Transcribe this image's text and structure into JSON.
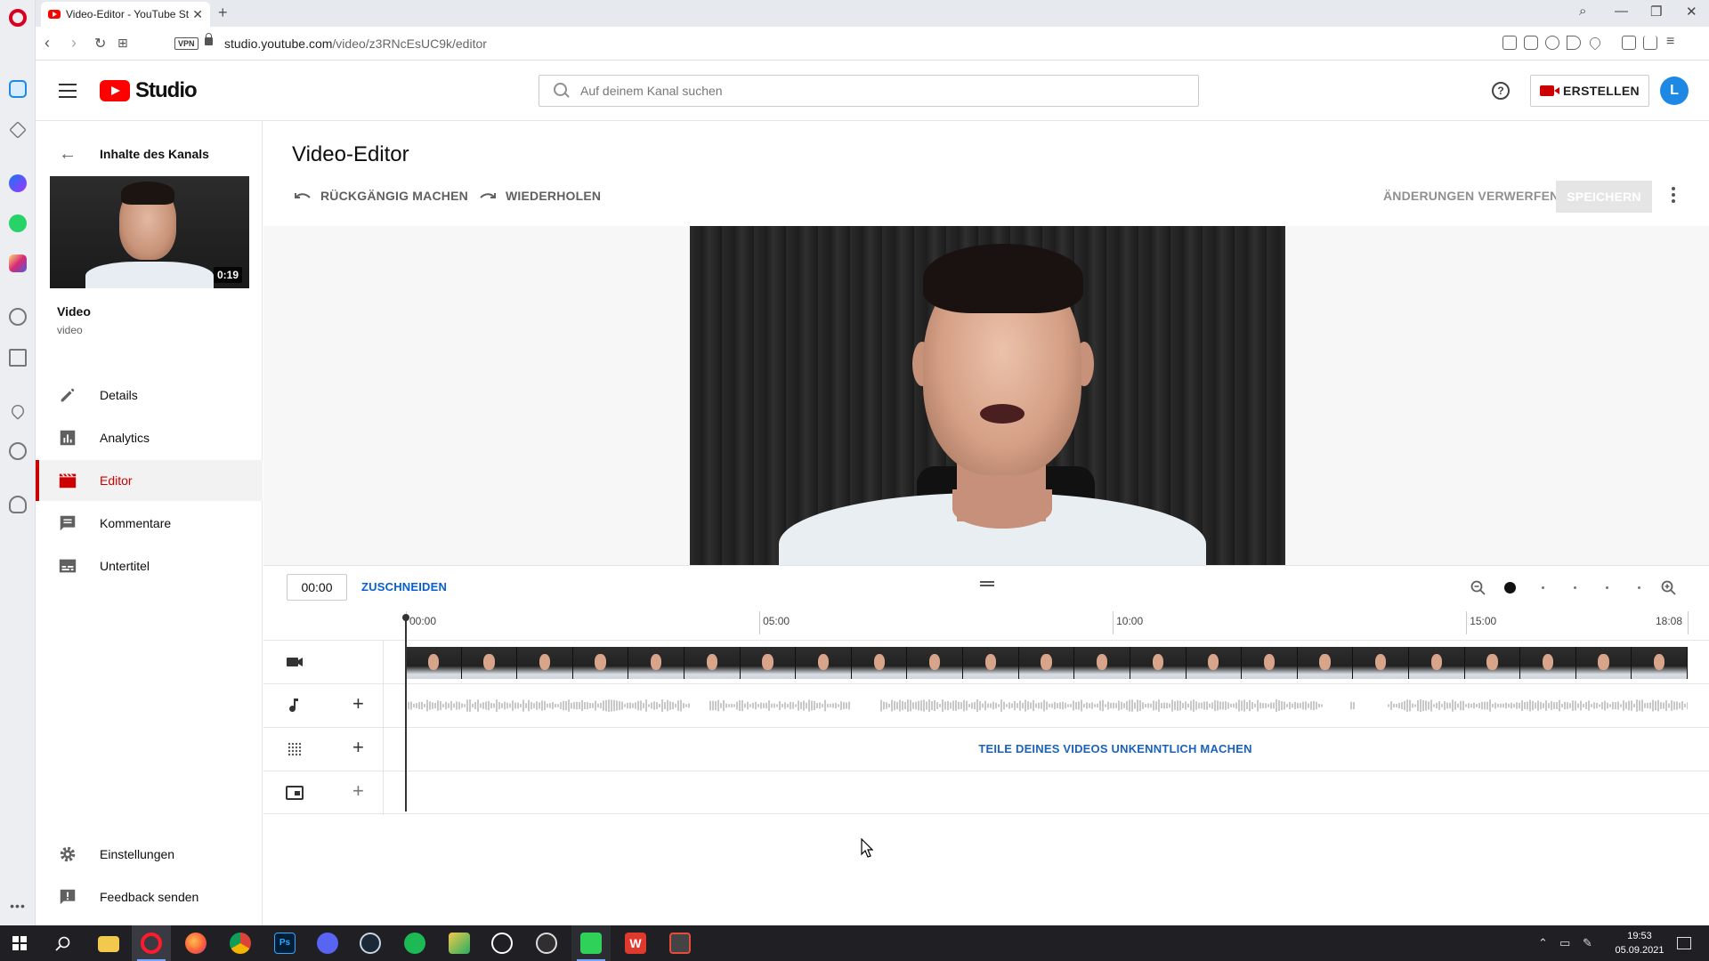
{
  "browser": {
    "tab_title": "Video-Editor - YouTube St",
    "tab_close": "✕",
    "new_tab": "+",
    "url_domain": "studio.youtube.com",
    "url_path": "/video/z3RNcEsUC9k/editor",
    "vpn_label": "VPN"
  },
  "header": {
    "logo_text": "Studio",
    "search_placeholder": "Auf deinem Kanal suchen",
    "help_symbol": "?",
    "create_label": "ERSTELLEN",
    "avatar_letter": "L"
  },
  "sidebar": {
    "back_label": "Inhalte des Kanals",
    "thumbnail_duration": "0:19",
    "video_title": "Video",
    "video_subtitle": "video",
    "items": [
      {
        "label": "Details",
        "icon": "pencil-icon",
        "active": false
      },
      {
        "label": "Analytics",
        "icon": "bar-chart-icon",
        "active": false
      },
      {
        "label": "Editor",
        "icon": "clapper-icon",
        "active": true
      },
      {
        "label": "Kommentare",
        "icon": "comment-icon",
        "active": false
      },
      {
        "label": "Untertitel",
        "icon": "subtitles-icon",
        "active": false
      }
    ],
    "footer": [
      {
        "label": "Einstellungen",
        "icon": "gear-icon"
      },
      {
        "label": "Feedback senden",
        "icon": "feedback-icon"
      }
    ]
  },
  "editor": {
    "title": "Video-Editor",
    "undo_label": "RÜCKGÄNGIG MACHEN",
    "redo_label": "WIEDERHOLEN",
    "discard_label": "ÄNDERUNGEN VERWERFEN",
    "save_label": "SPEICHERN"
  },
  "timeline": {
    "timecode": "00:00",
    "trim_label": "ZUSCHNEIDEN",
    "ruler_labels": [
      "00:00",
      "05:00",
      "10:00",
      "15:00",
      "18:08"
    ],
    "ruler_minutes": [
      0,
      5,
      10,
      15,
      18.133
    ],
    "duration_minutes": 18.133,
    "blur_label": "TEILE DEINES VIDEOS UNKENNTLICH MACHEN",
    "playhead_minutes": 0,
    "zoom_level": 0
  },
  "taskbar": {
    "time": "19:53",
    "date": "05.09.2021"
  },
  "colors": {
    "accent_red": "#cc0000",
    "link_blue": "#065fd4",
    "avatar_blue": "#1e88e5"
  }
}
